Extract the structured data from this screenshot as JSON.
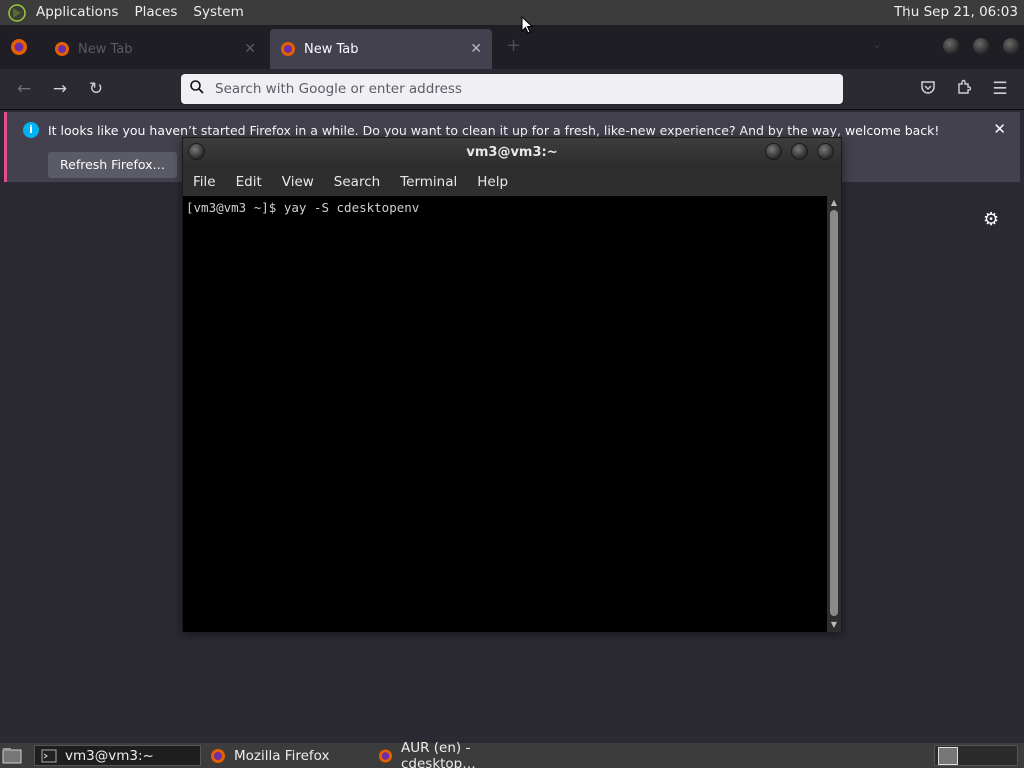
{
  "top_panel": {
    "menus": [
      "Applications",
      "Places",
      "System"
    ],
    "clock": "Thu Sep 21, 06:03"
  },
  "firefox": {
    "tabs": [
      {
        "title": "New Tab",
        "active": false
      },
      {
        "title": "New Tab",
        "active": true
      }
    ],
    "new_tab_glyph": "+",
    "url_placeholder": "Search with Google or enter address",
    "notification": {
      "message": "It looks like you haven’t started Firefox in a while. Do you want to clean it up for a fresh, like-new experience? And by the way, welcome back!",
      "button_label": "Refresh Firefox…"
    }
  },
  "terminal": {
    "title": "vm3@vm3:~",
    "menu": [
      "File",
      "Edit",
      "View",
      "Search",
      "Terminal",
      "Help"
    ],
    "lines": [
      "[vm3@vm3 ~]$ yay -S cdesktopenv"
    ]
  },
  "taskbar": {
    "items": [
      {
        "label": "vm3@vm3:~",
        "icon": "terminal-icon",
        "active": true
      },
      {
        "label": "Mozilla Firefox",
        "icon": "firefox-icon",
        "active": false
      },
      {
        "label": "AUR (en) - cdesktop…",
        "icon": "firefox-icon",
        "active": false
      }
    ]
  },
  "colors": {
    "panel": "#3c3c3c",
    "firefox_bg": "#2b2a33",
    "notification_accent": "#e04e91",
    "info_blue": "#00b3f4",
    "terminal_bg": "#000000"
  }
}
